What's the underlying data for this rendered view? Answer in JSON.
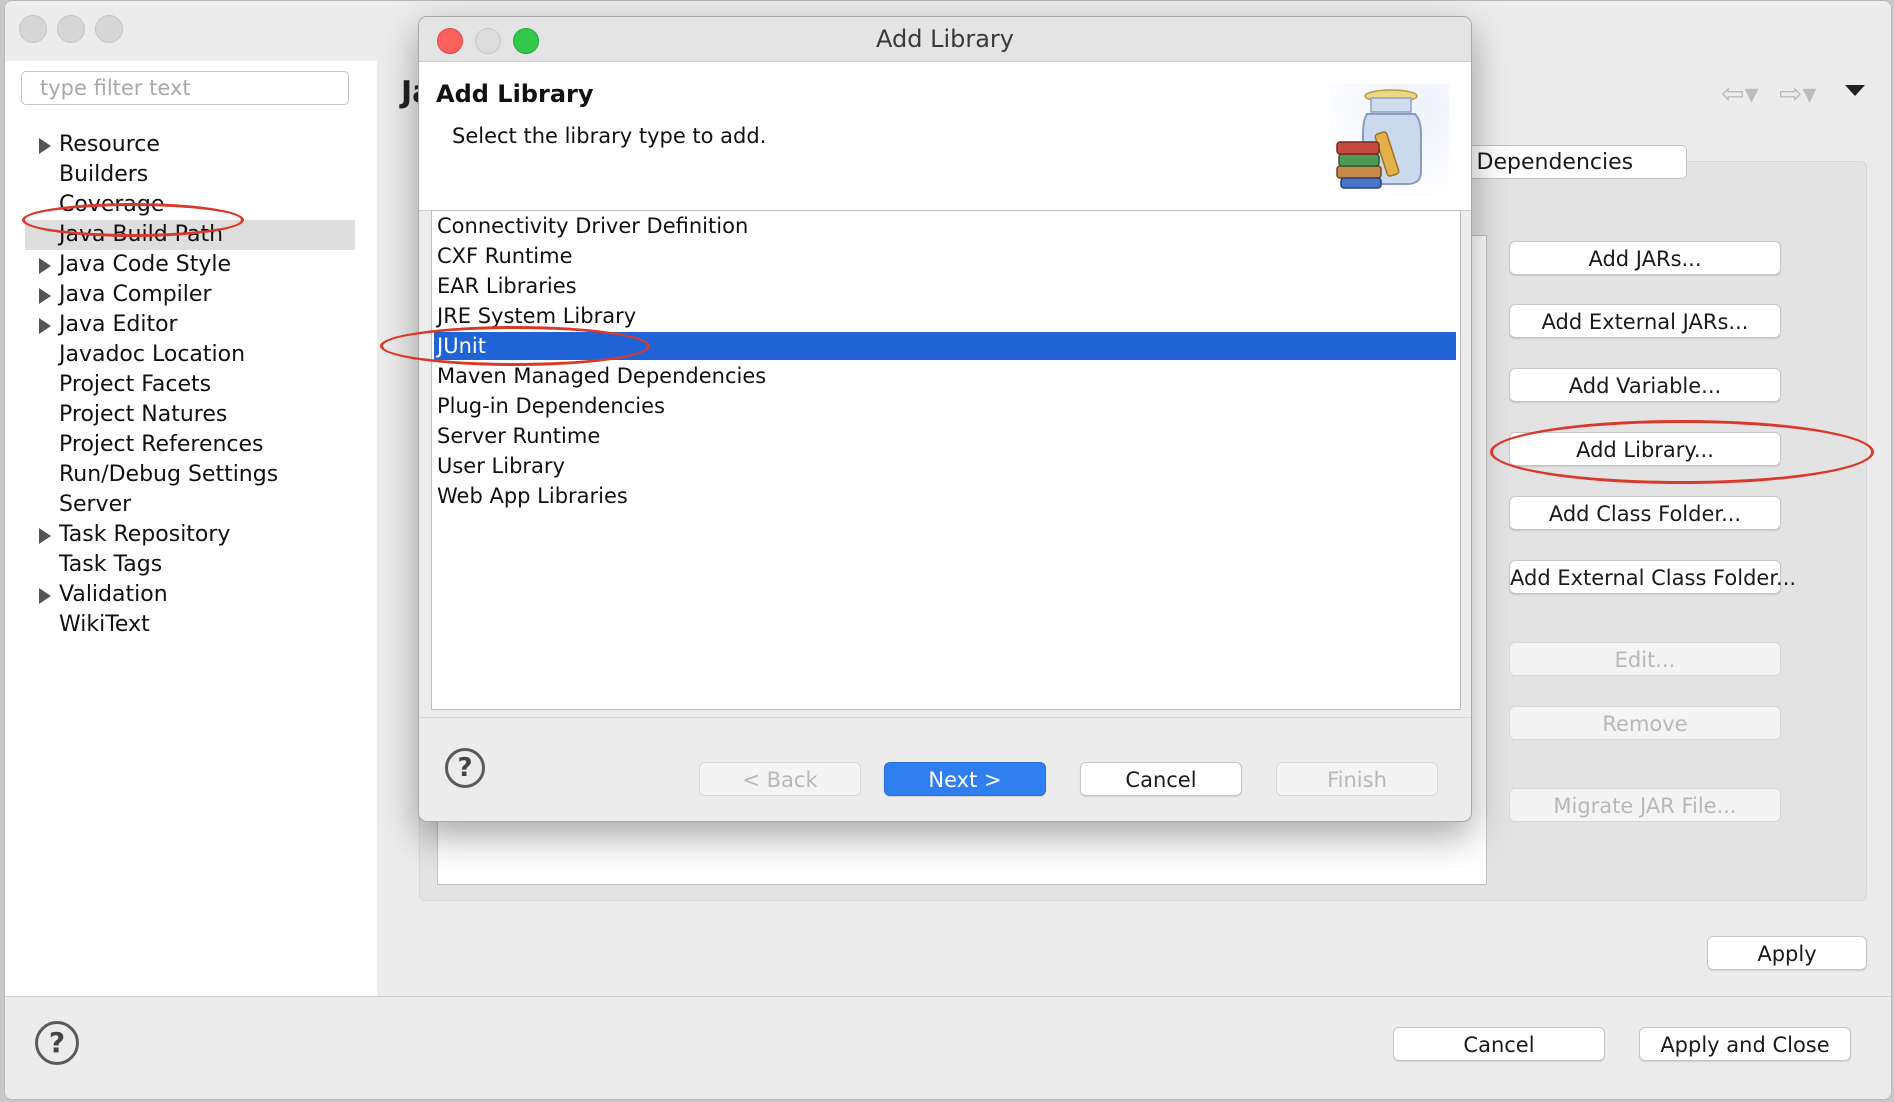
{
  "prefs": {
    "filter_placeholder": "type filter text",
    "heading_partial": "Ja",
    "nav_back_icon": "back-arrow-icon",
    "nav_forward_icon": "forward-arrow-icon",
    "tree": [
      {
        "label": "Resource",
        "expandable": true
      },
      {
        "label": "Builders",
        "expandable": false
      },
      {
        "label": "Coverage",
        "expandable": false
      },
      {
        "label": "Java Build Path",
        "expandable": false,
        "selected": true
      },
      {
        "label": "Java Code Style",
        "expandable": true
      },
      {
        "label": "Java Compiler",
        "expandable": true
      },
      {
        "label": "Java Editor",
        "expandable": true
      },
      {
        "label": "Javadoc Location",
        "expandable": false
      },
      {
        "label": "Project Facets",
        "expandable": false
      },
      {
        "label": "Project Natures",
        "expandable": false
      },
      {
        "label": "Project References",
        "expandable": false
      },
      {
        "label": "Run/Debug Settings",
        "expandable": false
      },
      {
        "label": "Server",
        "expandable": false
      },
      {
        "label": "Task Repository",
        "expandable": true
      },
      {
        "label": "Task Tags",
        "expandable": false
      },
      {
        "label": "Validation",
        "expandable": true
      },
      {
        "label": "WikiText",
        "expandable": false
      }
    ],
    "visible_tab": "e Dependencies",
    "side_buttons": {
      "add_jars": "Add JARs...",
      "add_external_jars": "Add External JARs...",
      "add_variable": "Add Variable...",
      "add_library": "Add Library...",
      "add_class_folder": "Add Class Folder...",
      "add_external_class_folder": "Add External Class Folder...",
      "edit": "Edit...",
      "remove": "Remove",
      "migrate_jar": "Migrate JAR File..."
    },
    "apply": "Apply",
    "cancel": "Cancel",
    "apply_and_close": "Apply and Close"
  },
  "dialog": {
    "window_title": "Add Library",
    "header_title": "Add Library",
    "header_description": "Select the library type to add.",
    "library_types": [
      "Connectivity Driver Definition",
      "CXF Runtime",
      "EAR Libraries",
      "JRE System Library",
      "JUnit",
      "Maven Managed Dependencies",
      "Plug-in Dependencies",
      "Server Runtime",
      "User Library",
      "Web App Libraries"
    ],
    "selected_library": "JUnit",
    "buttons": {
      "back": "< Back",
      "next": "Next >",
      "cancel": "Cancel",
      "finish": "Finish"
    }
  },
  "colors": {
    "selection": "#1f63d6",
    "primary_button": "#2f7ff0",
    "annotation": "#d9382b"
  }
}
